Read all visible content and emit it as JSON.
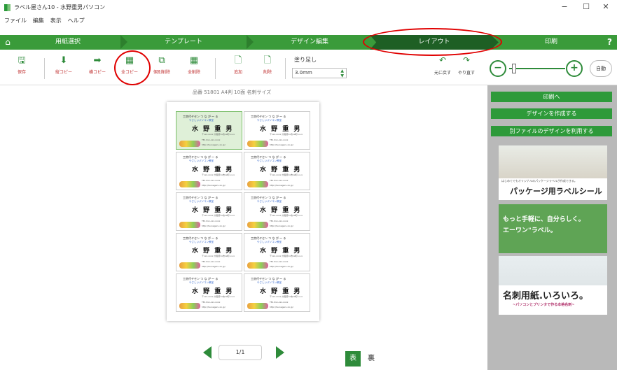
{
  "window": {
    "title": "ラベル屋さん10 - 水野重男パソコン",
    "minimize": "−",
    "maximize": "☐",
    "close": "✕"
  },
  "menu": [
    "ファイル",
    "編集",
    "表示",
    "ヘルプ"
  ],
  "steps": [
    "用紙選択",
    "テンプレート",
    "デザイン編集",
    "レイアウト",
    "印刷"
  ],
  "active_step": "レイアウト",
  "toolbar": {
    "save": "保存",
    "vcopy": "縦コピー",
    "hcopy": "横コピー",
    "allcopy": "全コピー",
    "delete_one": "個別削除",
    "delete_all": "全削除",
    "add": "追加",
    "remove": "削除",
    "margin_label": "塗り足し",
    "margin_value": "3.0mm",
    "undo": "元に戻す",
    "redo": "やり直す",
    "auto": "自動",
    "zoom_percent": 10
  },
  "document": {
    "caption": "品番 51801 A4判 10面 名刺サイズ",
    "page": "1/1",
    "front": "表",
    "back": "裏"
  },
  "card": {
    "line1": "工房代ヤセン つ な が ～ る",
    "line2": "やさしいパソコン教室",
    "name": "水 野 重 男",
    "addr1": "〒xxx-xxxx 大阪府xx市xx町x-x-x",
    "addr2": "TEL 0xx-xxx-xxxx",
    "addr3": "http://tsunagaru-xx.jp/"
  },
  "sidebar": {
    "print_btn": "印刷へ",
    "create_btn": "デザインを作成する",
    "other_btn": "別ファイルのデザインを利用する",
    "ad1_small": "はじめてでもオリジナルのパッケージラベルが作成できる。",
    "ad1_title": "パッケージ用ラベルシール",
    "ad2_line1": "もっと手軽に、自分らしく。",
    "ad2_line2": "エーワン\"ラベル。",
    "ad3_title": "名刺用紙.いろいろ。",
    "ad3_small": "~パソコンとプリンタで作る本格名刺~"
  },
  "colors": {
    "green": "#3a9b3a",
    "active": "#1e5f24",
    "annotation": "#e00000"
  }
}
